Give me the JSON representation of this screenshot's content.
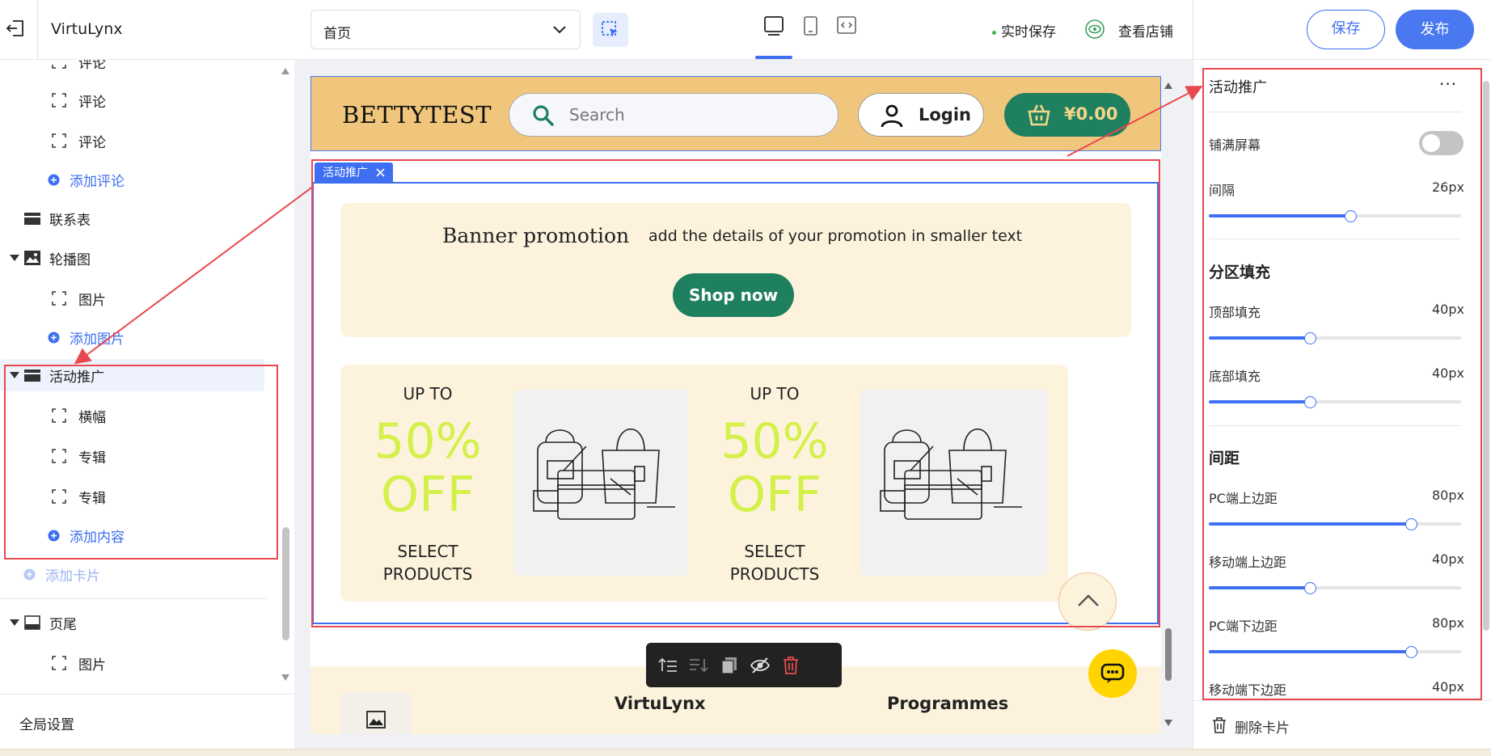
{
  "header": {
    "app_name": "VirtuLynx",
    "page_select": "首页",
    "autosave": "实时保存",
    "view_store": "查看店铺",
    "save": "保存",
    "publish": "发布"
  },
  "sidebar": {
    "items": [
      {
        "label": "评论",
        "type": "leaf"
      },
      {
        "label": "评论",
        "type": "leaf"
      },
      {
        "label": "评论",
        "type": "leaf"
      },
      {
        "label": "添加评论",
        "type": "add"
      },
      {
        "label": "联系表",
        "type": "section"
      },
      {
        "label": "轮播图",
        "type": "section"
      },
      {
        "label": "图片",
        "type": "leaf"
      },
      {
        "label": "添加图片",
        "type": "add"
      },
      {
        "label": "活动推广",
        "type": "section"
      },
      {
        "label": "横幅",
        "type": "leaf"
      },
      {
        "label": "专辑",
        "type": "leaf"
      },
      {
        "label": "专辑",
        "type": "leaf"
      },
      {
        "label": "添加内容",
        "type": "add"
      },
      {
        "label": "添加卡片",
        "type": "add"
      },
      {
        "label": "页尾",
        "type": "section"
      },
      {
        "label": "图片",
        "type": "leaf"
      }
    ],
    "global_settings": "全局设置"
  },
  "site": {
    "logo": "BETTYTEST",
    "search_placeholder": "Search",
    "login": "Login",
    "cart": "¥0.00",
    "selection_tag": "活动推广",
    "banner_title": "Banner promotion",
    "banner_sub": "add the details of your promotion in smaller text",
    "shop_now": "Shop now",
    "cards": [
      {
        "up_to": "UP TO",
        "pct": "50%",
        "off": "OFF",
        "sel1": "SELECT",
        "sel2": "PRODUCTS"
      },
      {
        "up_to": "UP TO",
        "pct": "50%",
        "off": "OFF",
        "sel1": "SELECT",
        "sel2": "PRODUCTS"
      }
    ],
    "footer_col1": "VirtuLynx",
    "footer_col2": "Programmes"
  },
  "panel": {
    "title": "活动推广",
    "more": "···",
    "full_screen": "铺满屏幕",
    "full_screen_on": false,
    "gap": {
      "label": "间隔",
      "value": "26px",
      "fraction": 0.56
    },
    "section_fill": "分区填充",
    "top_fill": {
      "label": "顶部填充",
      "value": "40px",
      "fraction": 0.4
    },
    "bottom_fill": {
      "label": "底部填充",
      "value": "40px",
      "fraction": 0.4
    },
    "spacing": "间距",
    "pc_top": {
      "label": "PC端上边距",
      "value": "80px",
      "fraction": 0.8
    },
    "mobile_top": {
      "label": "移动端上边距",
      "value": "40px",
      "fraction": 0.4
    },
    "pc_bottom": {
      "label": "PC端下边距",
      "value": "80px",
      "fraction": 0.8
    },
    "mobile_bottom": {
      "label": "移动端下边距",
      "value": "40px"
    },
    "delete_card": "删除卡片"
  },
  "colors": {
    "accent": "#3e6ff2",
    "annotation": "#e8484f",
    "header_bg": "#f0c67c",
    "brand_green": "#1f8060",
    "promo_text": "#d4f04a"
  }
}
